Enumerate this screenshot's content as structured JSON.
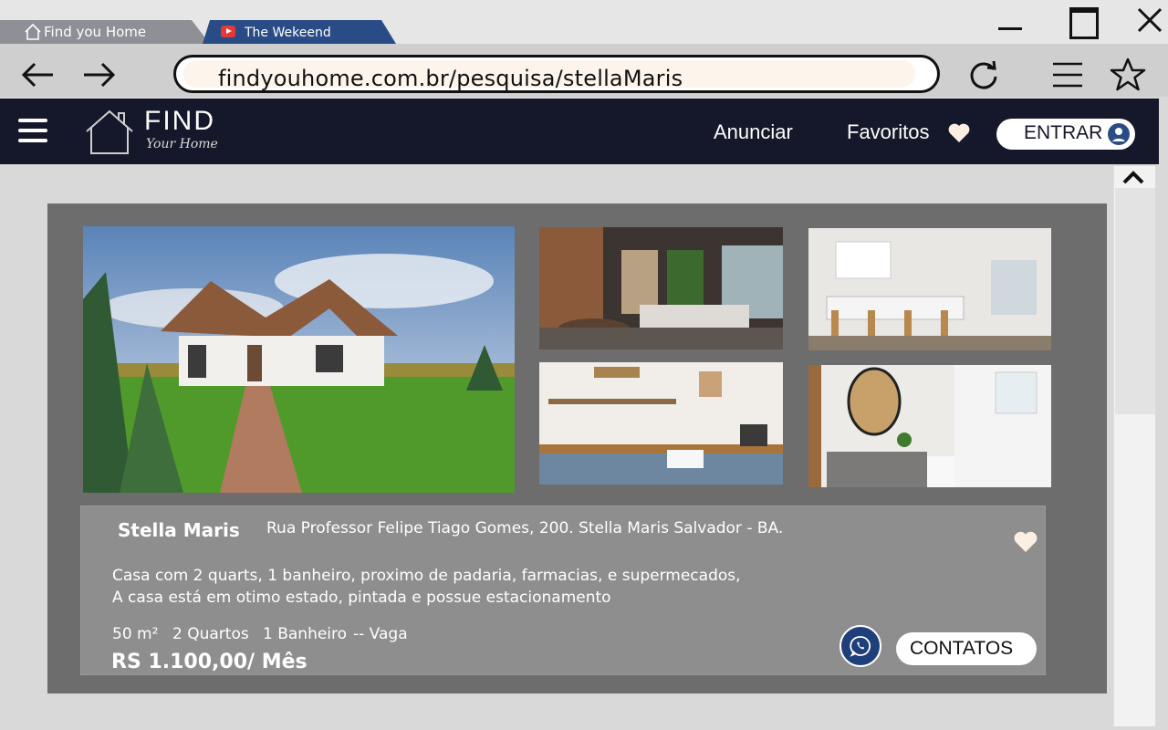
{
  "browser": {
    "tabs": [
      {
        "label": "Find you Home",
        "icon": "home-icon"
      },
      {
        "label": "The Wekeend",
        "icon": "youtube-icon",
        "color": "#2a4c86"
      }
    ],
    "url": "findyouhome.com.br/pesquisa/stellaMaris"
  },
  "header": {
    "logo_title": "FIND",
    "logo_subtitle": "Your Home",
    "nav": {
      "anunciar": "Anunciar",
      "favoritos": "Favoritos"
    },
    "login_label": "ENTRAR",
    "background": "#15172a"
  },
  "listing": {
    "title": "Stella Maris",
    "address": "Rua Professor Felipe Tiago Gomes, 200. Stella Maris Salvador - BA.",
    "description_line1": "Casa com 2 quarts, 1 banheiro, proximo de padaria, farmacias, e supermecados,",
    "description_line2": "A casa está em otimo estado, pintada e possue estacionamento",
    "features": {
      "area": "50 m²",
      "quartos": "2 Quartos",
      "banheiro": "1 Banheiro",
      "vaga": "-- Vaga"
    },
    "price": "RS 1.100,00/ Mês",
    "contact_label": "CONTATOS",
    "photos": [
      "house-exterior",
      "living-room",
      "kitchen-island",
      "kitchen-counter",
      "bathroom"
    ]
  }
}
